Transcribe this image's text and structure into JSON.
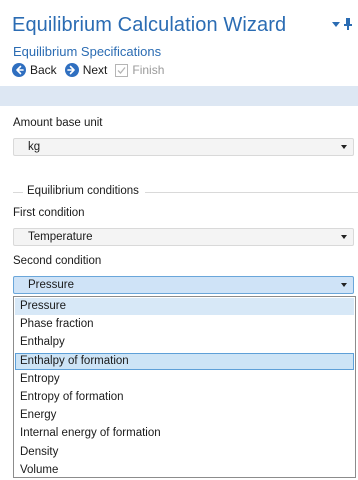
{
  "wizard": {
    "title": "Equilibrium Calculation Wizard",
    "subtitle": "Equilibrium Specifications"
  },
  "nav": {
    "back": "Back",
    "next": "Next",
    "finish": "Finish"
  },
  "amount": {
    "label": "Amount base unit",
    "value": "kg"
  },
  "conditions": {
    "group_label": "Equilibrium conditions",
    "first_label": "First condition",
    "first_value": "Temperature",
    "second_label": "Second condition",
    "second_value": "Pressure"
  },
  "dropdown": {
    "options": [
      "Pressure",
      "Phase fraction",
      "Enthalpy",
      "Enthalpy of formation",
      "Entropy",
      "Entropy of formation",
      "Energy",
      "Internal energy of formation",
      "Density",
      "Volume"
    ],
    "hover_index": 0,
    "highlight_index": 3
  },
  "colors": {
    "accent": "#2b6cb3",
    "header_bar": "#dde7f3",
    "open_combo": "#cfe3f7",
    "highlight": "#cde4f6"
  }
}
